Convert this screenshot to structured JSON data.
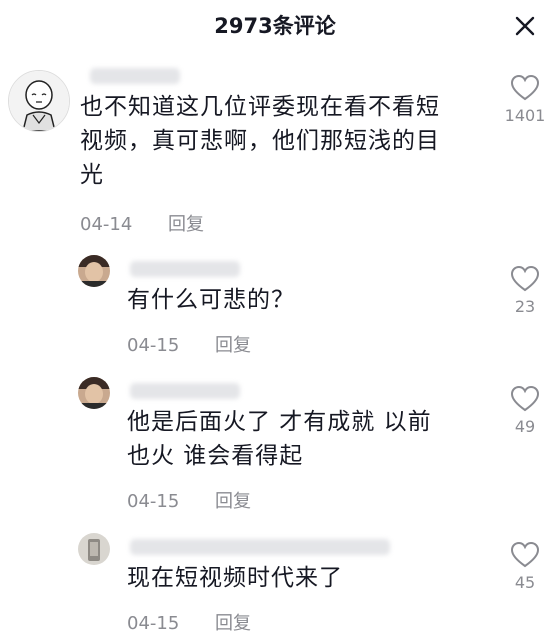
{
  "header": {
    "title": "2973条评论"
  },
  "icons": {
    "close": "close-icon",
    "like": "heart-outline-icon"
  },
  "comments": [
    {
      "text_lines": [
        "也不知道这几位评委现在看不看短",
        "视频，真可悲啊，他们那短浅的目",
        "光"
      ],
      "date": "04-14",
      "reply_label": "回复",
      "likes": "1401"
    },
    {
      "text_lines": [
        "有什么可悲的？"
      ],
      "date": "04-15",
      "reply_label": "回复",
      "likes": "23"
    },
    {
      "text_lines": [
        "他是后面火了 才有成就 以前",
        "也火  谁会看得起"
      ],
      "date": "04-15",
      "reply_label": "回复",
      "likes": "49"
    },
    {
      "text_lines": [
        "现在短视频时代来了"
      ],
      "date": "04-15",
      "reply_label": "回复",
      "likes": "45"
    }
  ]
}
